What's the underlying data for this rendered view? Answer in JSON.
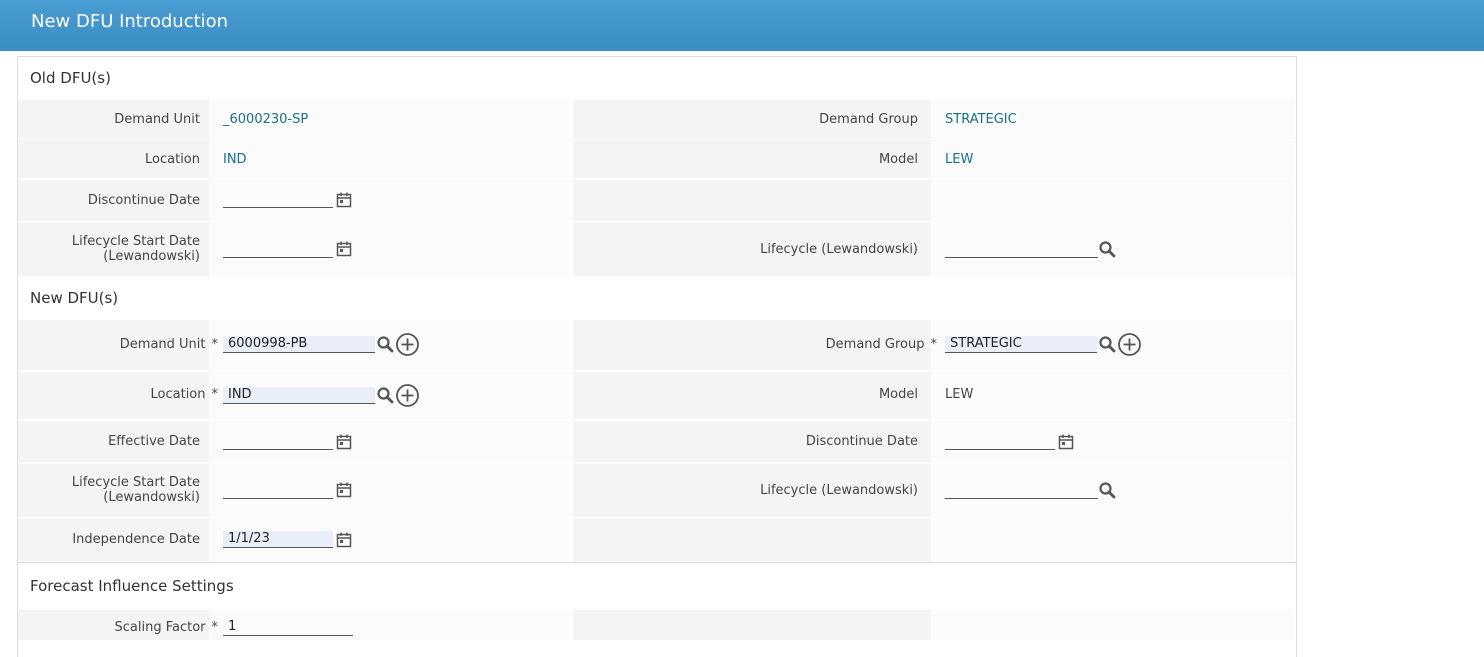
{
  "window": {
    "title": "New DFU Introduction"
  },
  "old": {
    "section_title": "Old DFU(s)",
    "demand_unit_label": "Demand Unit",
    "demand_unit_value": "_6000230-SP",
    "demand_group_label": "Demand Group",
    "demand_group_value": "STRATEGIC",
    "location_label": "Location",
    "location_value": "IND",
    "model_label": "Model",
    "model_value": "LEW",
    "discontinue_label": "Discontinue Date",
    "lifecycle_start_label_1": "Lifecycle Start Date",
    "lifecycle_start_label_2": "(Lewandowski)",
    "lifecycle_label": "Lifecycle (Lewandowski)"
  },
  "new": {
    "section_title": "New DFU(s)",
    "demand_unit_label": "Demand Unit",
    "demand_unit_value": "6000998-PB",
    "demand_group_label": "Demand Group",
    "demand_group_value": "STRATEGIC",
    "location_label": "Location",
    "location_value": "IND",
    "model_label": "Model",
    "model_value": "LEW",
    "effective_label": "Effective Date",
    "discontinue_label": "Discontinue Date",
    "lifecycle_start_label_1": "Lifecycle Start Date",
    "lifecycle_start_label_2": "(Lewandowski)",
    "lifecycle_label": "Lifecycle (Lewandowski)",
    "independence_label": "Independence Date",
    "independence_value": "1/1/23",
    "required_mark": "*"
  },
  "forecast": {
    "section_title": "Forecast Influence Settings",
    "scaling_label": "Scaling Factor",
    "scaling_value": "1"
  },
  "icons": {
    "calendar": "calendar-icon",
    "search": "search-icon",
    "add": "add-circle-icon"
  },
  "colors": {
    "header": "#3a8dc3",
    "link": "#1a6f88"
  }
}
